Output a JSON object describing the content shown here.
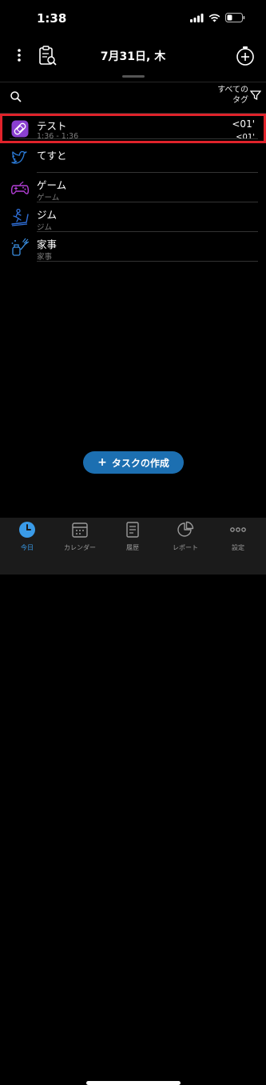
{
  "status_bar": {
    "time": "1:38"
  },
  "header": {
    "date_title": "7月31日, 木"
  },
  "filter": {
    "tag_filter_label_line1": "すべての",
    "tag_filter_label_line2": "タグ"
  },
  "tasks": [
    {
      "name": "テスト",
      "subtitle": "1:36 - 1:36",
      "duration": "<01'",
      "duration_secondary": "<01'",
      "icon": "bandage-icon",
      "color": "#8a3fd0"
    },
    {
      "name": "てすと",
      "subtitle": "",
      "duration": "",
      "duration_secondary": "",
      "icon": "twitter-bird-icon",
      "color": "#2b7bd8"
    },
    {
      "name": "ゲーム",
      "subtitle": "ゲーム",
      "duration": "",
      "duration_secondary": "",
      "icon": "gamepad-icon",
      "color": "#b23fd6"
    },
    {
      "name": "ジム",
      "subtitle": "ジム",
      "duration": "",
      "duration_secondary": "",
      "icon": "treadmill-icon",
      "color": "#2f6fd8"
    },
    {
      "name": "家事",
      "subtitle": "家事",
      "duration": "",
      "duration_secondary": "",
      "icon": "cleaning-icon",
      "color": "#3a8ee0"
    }
  ],
  "create_button": {
    "label": "タスクの作成"
  },
  "tabbar": {
    "today": "今日",
    "calendar": "カレンダー",
    "history": "履歴",
    "report": "レポート",
    "settings": "設定",
    "active_color": "#3a9be8"
  },
  "colors": {
    "accent": "#1c6fb1",
    "highlight": "#e0232b"
  }
}
